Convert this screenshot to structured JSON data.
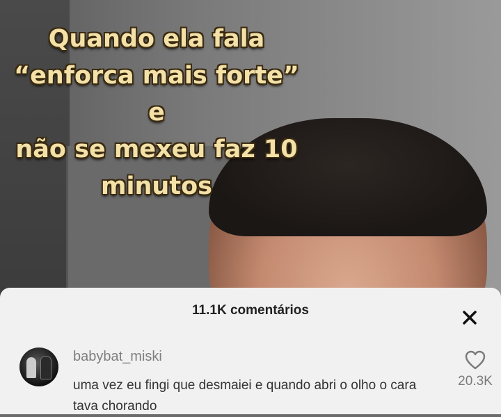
{
  "video": {
    "caption": "Quando ela fala\n“enforca mais forte” e\nnão se mexeu faz 10\nminutos"
  },
  "comments_sheet": {
    "title": "11.1K comentários",
    "close_icon": "close-icon"
  },
  "comments": [
    {
      "username": "babybat_miski",
      "text": "uma vez eu fingi que desmaiei e quando abri o olho o cara tava chorando",
      "likes": "20.3K",
      "like_icon": "heart-outline-icon"
    }
  ]
}
